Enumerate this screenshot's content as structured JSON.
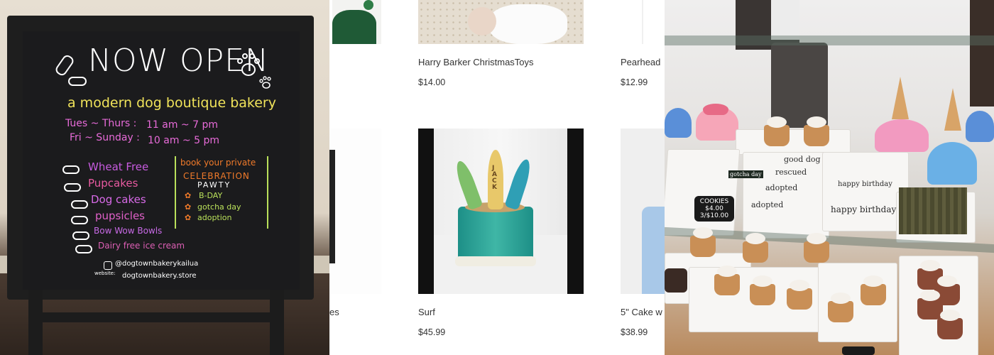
{
  "chalkboard": {
    "title": "NOW  OPEN",
    "tagline": "a modern dog boutique bakery",
    "hours": [
      {
        "days": "Tues ~ Thurs :",
        "time": "11 am ~ 7 pm"
      },
      {
        "days": "Fri ~ Sunday :",
        "time": "10 am ~ 5 pm"
      }
    ],
    "menu_items": [
      {
        "label": "Wheat Free",
        "color": "#c85be0"
      },
      {
        "label": "Pupcakes",
        "color": "#e85aa0"
      },
      {
        "label": "Dog cakes",
        "color": "#d86ae8"
      },
      {
        "label": "pupsicles",
        "color": "#e060c8"
      },
      {
        "label": "Bow Wow Bowls",
        "color": "#c86ae6"
      },
      {
        "label": "Dairy free  ice cream",
        "color": "#dc5fb4"
      }
    ],
    "party": {
      "line1": "book your private",
      "line2": "CELEBRATION",
      "line3": "PAWTY",
      "items": [
        "B-DAY",
        "gotcha day",
        "adoption"
      ]
    },
    "social_handle": "@dogtownbakerykailua",
    "website_label": "website:",
    "website": "dogtownbakery.store",
    "colors": {
      "title": "#ffffff",
      "tagline": "#f0e35a",
      "hours": "#e86bd9",
      "party": "#f07a2a",
      "party_frame": "#b9e05a"
    }
  },
  "products": [
    {
      "name": "Harry Barker ChristmasToys",
      "price": "$14.00"
    },
    {
      "name": "Pearhead",
      "price": "$12.99"
    },
    {
      "name": "es",
      "price": ""
    },
    {
      "name": "Surf",
      "price": "$45.99"
    },
    {
      "name": "5\" Cake w",
      "price": "$38.99"
    }
  ],
  "surf_cake": {
    "board_text": "JACK"
  },
  "display_case": {
    "treats": [
      "good dog",
      "rescued",
      "adopted",
      "adopted",
      "happy birthday",
      "happy birthday",
      "gotcha day"
    ],
    "sign_lines": [
      "COOKIES",
      "$4.00",
      "3/$10.00"
    ]
  }
}
